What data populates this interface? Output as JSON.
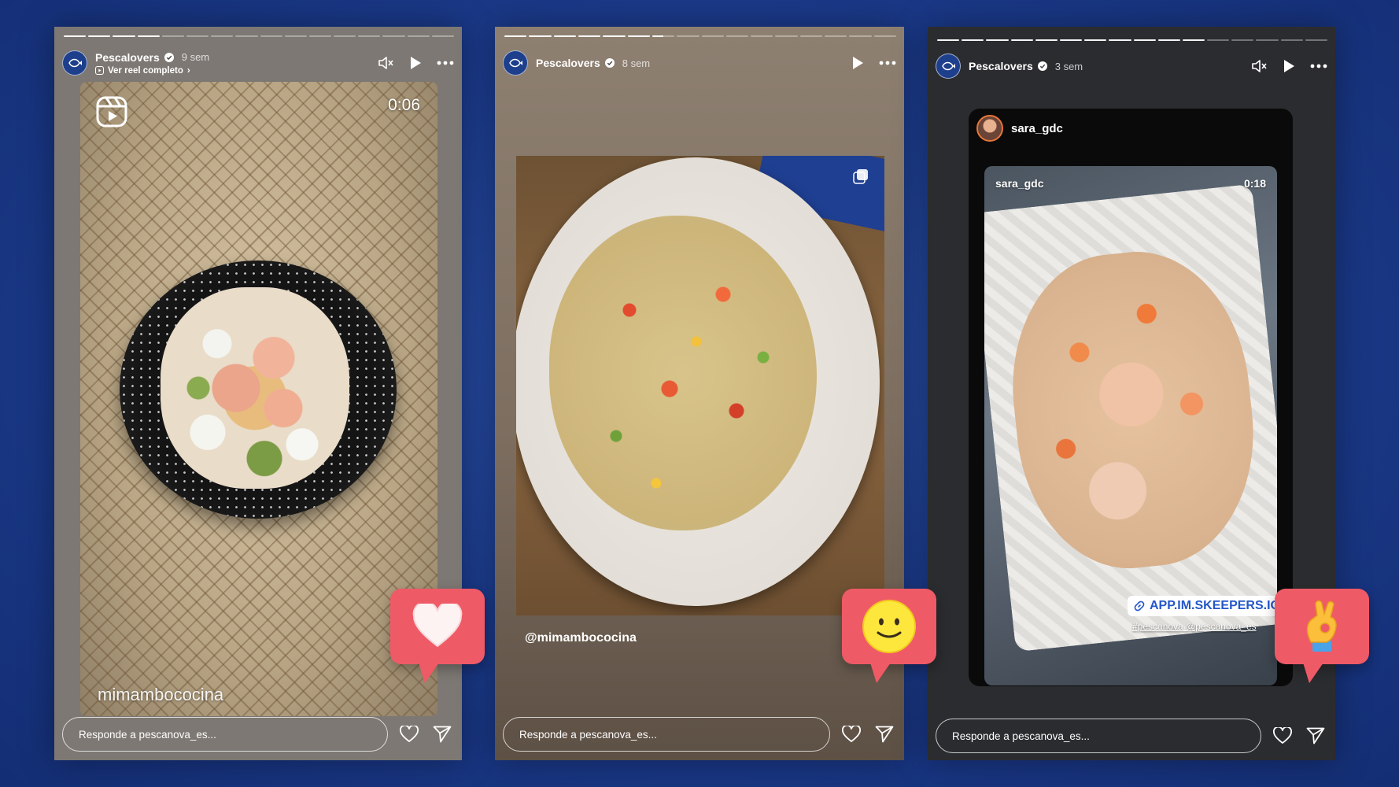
{
  "stories": [
    {
      "username": "Pescalovers",
      "time": "9 sem",
      "sub_link": "Ver reel completo",
      "timer": "0:06",
      "caption": "mimambococina",
      "reply_placeholder": "Responde a pescanova_es...",
      "progress": {
        "segments": 16,
        "viewed": 4
      }
    },
    {
      "username": "Pescalovers",
      "time": "8 sem",
      "caption": "@mimambococina",
      "reply_placeholder": "Responde a pescanova_es...",
      "progress": {
        "segments": 16,
        "viewed": 6,
        "current_fraction": 0.5
      }
    },
    {
      "username": "Pescalovers",
      "time": "3 sem",
      "card_user": "sara_gdc",
      "video_user": "sara_gdc",
      "video_time": "0:18",
      "link_text": "APP.IM.SKEEPERS.IO",
      "hashtags": "#pescanova @pescanova_es",
      "reply_placeholder": "Responde a pescanova_es...",
      "progress": {
        "segments": 16,
        "viewed": 11
      }
    }
  ],
  "reactions": [
    "heart-reaction",
    "smiley-reaction",
    "ok-hand-reaction"
  ],
  "colors": {
    "background": "#1c3c8e",
    "bubble": "#ef5a67",
    "avatar": "#1d3f8c",
    "link": "#2457c9"
  }
}
